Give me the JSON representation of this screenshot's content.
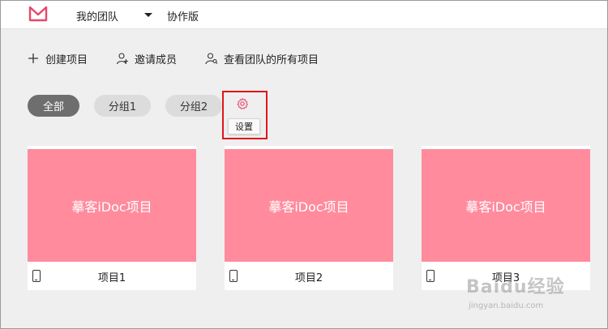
{
  "header": {
    "logo_icon": "m-logo-icon",
    "team_name": "我的团队",
    "edition": "协作版"
  },
  "actions": {
    "create": "创建项目",
    "invite": "邀请成员",
    "view_all": "查看团队的所有项目"
  },
  "tabs": [
    {
      "label": "全部",
      "active": true
    },
    {
      "label": "分组1",
      "active": false
    },
    {
      "label": "分组2",
      "active": false
    }
  ],
  "settings": {
    "tooltip": "设置",
    "highlight_color": "#e0161b"
  },
  "projects": [
    {
      "cover_text": "摹客iDoc项目",
      "name": "项目1"
    },
    {
      "cover_text": "摹客iDoc项目",
      "name": "项目2"
    },
    {
      "cover_text": "摹客iDoc项目",
      "name": "项目3"
    }
  ],
  "colors": {
    "cover": "#ff8b9d",
    "active_tab": "#6e6e6e",
    "logo": "#e8476a"
  },
  "watermark": {
    "text": "Baidu经验",
    "url": "jingyan.baidu.com"
  }
}
